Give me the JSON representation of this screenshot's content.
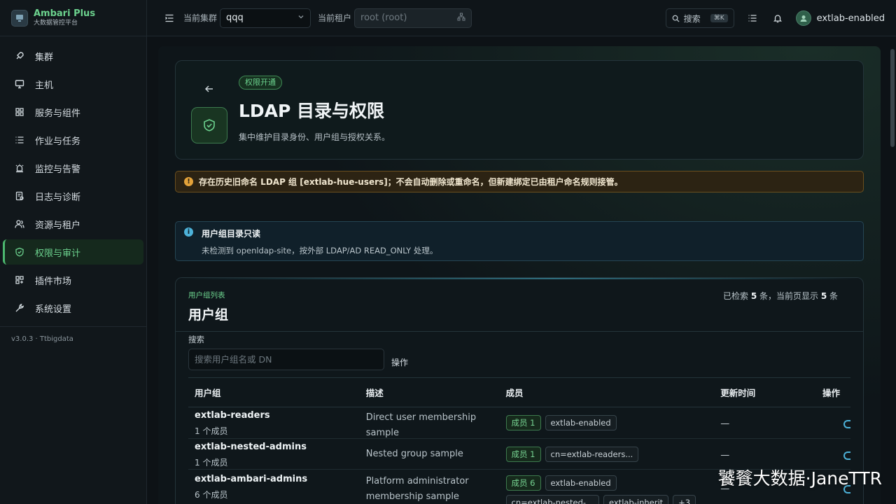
{
  "brand": {
    "name": "Ambari Plus",
    "subtitle": "大数据管控平台"
  },
  "sidebar": {
    "items": [
      {
        "label": "集群",
        "icon": "rocket-icon"
      },
      {
        "label": "主机",
        "icon": "monitor-icon"
      },
      {
        "label": "服务与组件",
        "icon": "grid-icon"
      },
      {
        "label": "作业与任务",
        "icon": "list-icon"
      },
      {
        "label": "监控与告警",
        "icon": "alarm-icon"
      },
      {
        "label": "日志与诊断",
        "icon": "log-icon"
      },
      {
        "label": "资源与租户",
        "icon": "users-icon"
      },
      {
        "label": "权限与审计",
        "icon": "shield-icon",
        "active": true
      },
      {
        "label": "插件市场",
        "icon": "plugin-icon"
      },
      {
        "label": "系统设置",
        "icon": "wrench-icon"
      }
    ],
    "version": "v3.0.3 · Ttbigdata"
  },
  "topbar": {
    "cluster_label": "当前集群",
    "cluster_value": "qqq",
    "tenant_label": "当前租户",
    "tenant_value": "root (root)",
    "search_label": "搜索",
    "search_shortcut": "⌘K",
    "user": "extlab-enabled"
  },
  "header": {
    "badge": "权限开通",
    "title": "LDAP 目录与权限",
    "description": "集中维护目录身份、用户组与授权关系。"
  },
  "warning": {
    "text": "存在历史旧命名 LDAP 组 [extlab-hue-users]；不会自动删除或重命名，但新建绑定已由租户命名规则接管。"
  },
  "info": {
    "title": "用户组目录只读",
    "description": "未检测到 openldap-site，按外部 LDAP/AD READ_ONLY 处理。"
  },
  "groups_card": {
    "overline": "用户组列表",
    "title": "用户组",
    "count_prefix": "已检索 ",
    "count_total": "5",
    "count_mid": " 条，当前页显示 ",
    "count_shown": "5",
    "count_suffix": " 条",
    "search_label": "搜索",
    "search_placeholder": "搜索用户组名或 DN",
    "ops_label": "操作",
    "columns": {
      "name": "用户组",
      "desc": "描述",
      "members": "成员",
      "updated": "更新时间",
      "ops": "操作"
    },
    "rows": [
      {
        "name": "extlab-readers",
        "member_count": "1 个成员",
        "desc": "Direct user membership sample",
        "member_badge": "成员 1",
        "member_chips": [
          "extlab-enabled"
        ],
        "updated": "—"
      },
      {
        "name": "extlab-nested-admins",
        "member_count": "1 个成员",
        "desc": "Nested group sample",
        "member_badge": "成员 1",
        "member_chips": [
          "cn=extlab-readers..."
        ],
        "updated": "—"
      },
      {
        "name": "extlab-ambari-admins",
        "member_count": "6 个成员",
        "desc": "Platform administrator membership sample",
        "member_badge": "成员 6",
        "member_chips": [
          "extlab-enabled",
          "cn=extlab-nested-...",
          "extlab-inherit",
          "+3"
        ],
        "updated": "—"
      }
    ]
  },
  "watermark": "饕餮大数据·JaneTTR"
}
